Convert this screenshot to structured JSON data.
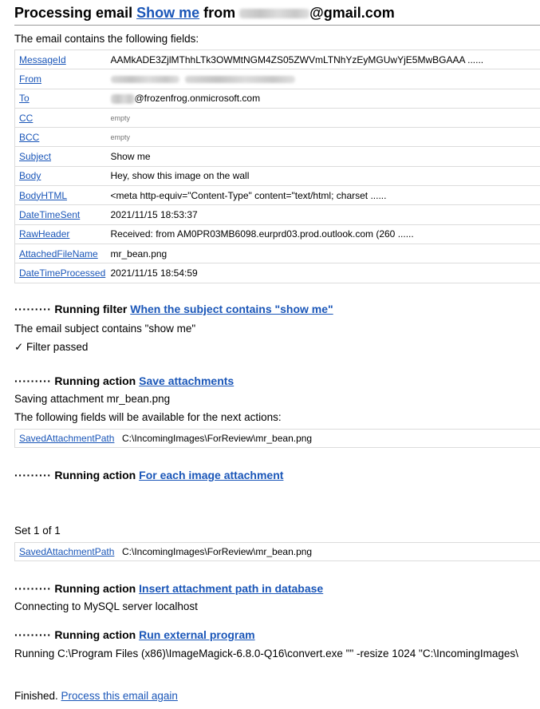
{
  "header": {
    "prefix": "Processing email",
    "subject_link": "Show me",
    "from_word": "from",
    "email_suffix": "@gmail.com"
  },
  "intro": "The email contains the following fields:",
  "fields": [
    {
      "name": "MessageId",
      "value": "AAMkADE3ZjlMThhLTk3OWMtNGM4ZS05ZWVmLTNhYzEyMGUwYjE5MwBGAAA  ......"
    },
    {
      "name": "From",
      "value": ""
    },
    {
      "name": "To",
      "value": "@frozenfrog.onmicrosoft.com"
    },
    {
      "name": "CC",
      "value": "empty"
    },
    {
      "name": "BCC",
      "value": "empty"
    },
    {
      "name": "Subject",
      "value": "Show me"
    },
    {
      "name": "Body",
      "value": "Hey, show this image on the wall"
    },
    {
      "name": "BodyHTML",
      "value": "<meta http-equiv=\"Content-Type\" content=\"text/html; charset  ......"
    },
    {
      "name": "DateTimeSent",
      "value": "2021/11/15 18:53:37"
    },
    {
      "name": "RawHeader",
      "value": "Received: from AM0PR03MB6098.eurprd03.prod.outlook.com (260  ......"
    },
    {
      "name": "AttachedFileName",
      "value": "mr_bean.png"
    },
    {
      "name": "DateTimeProcessed",
      "value": "2021/11/15 18:54:59"
    }
  ],
  "dots": "·········",
  "filter": {
    "heading": "Running filter",
    "link": "When the subject contains \"show me\"",
    "line1": "The email subject contains \"show me\"",
    "line2": "✓ Filter passed"
  },
  "action1": {
    "heading": "Running action",
    "link": "Save attachments",
    "line1": "Saving attachment mr_bean.png",
    "line2": "The following fields will be available for the next actions:",
    "field_name": "SavedAttachmentPath",
    "field_value": "C:\\IncomingImages\\ForReview\\mr_bean.png"
  },
  "action2": {
    "heading": "Running action",
    "link": "For each image attachment",
    "set_label": "Set 1 of 1",
    "field_name": "SavedAttachmentPath",
    "field_value": "C:\\IncomingImages\\ForReview\\mr_bean.png"
  },
  "action3": {
    "heading": "Running action",
    "link": "Insert attachment path in database",
    "line1": "Connecting to MySQL server localhost"
  },
  "action4": {
    "heading": "Running action",
    "link": "Run external program",
    "line1": "Running C:\\Program Files (x86)\\ImageMagick-6.8.0-Q16\\convert.exe \"\" -resize 1024 \"C:\\IncomingImages\\"
  },
  "footer": {
    "finished": "Finished.",
    "link": "Process this email again"
  },
  "colors": {
    "link": "#1a56b8",
    "border": "#dcdcdc"
  }
}
